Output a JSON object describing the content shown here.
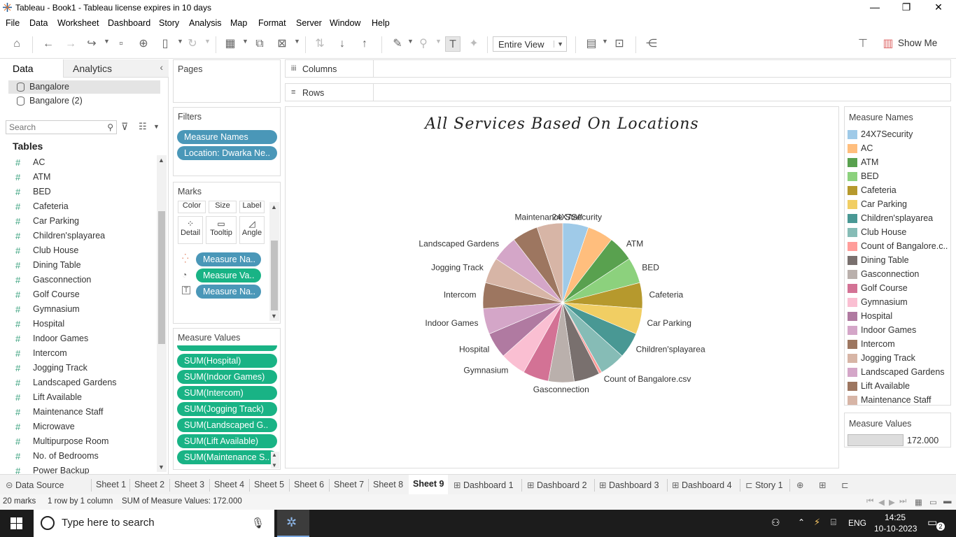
{
  "window": {
    "title": "Tableau - Book1 - Tableau license expires in 10 days"
  },
  "menu": [
    "File",
    "Data",
    "Worksheet",
    "Dashboard",
    "Story",
    "Analysis",
    "Map",
    "Format",
    "Server",
    "Window",
    "Help"
  ],
  "toolbar": {
    "view_select": "Entire View",
    "show_me": "Show Me"
  },
  "left_pane": {
    "tabs": [
      "Data",
      "Analytics"
    ],
    "datasources": [
      "Bangalore",
      "Bangalore (2)"
    ],
    "search_placeholder": "Search",
    "tables_heading": "Tables",
    "fields": [
      "AC",
      "ATM",
      "BED",
      "Cafeteria",
      "Car Parking",
      "Children'splayarea",
      "Club House",
      "Dining Table",
      "Gasconnection",
      "Golf Course",
      "Gymnasium",
      "Hospital",
      "Indoor Games",
      "Intercom",
      "Jogging Track",
      "Landscaped Gardens",
      "Lift Available",
      "Maintenance Staff",
      "Microwave",
      "Multipurpose Room",
      "No. of Bedrooms",
      "Power Backup"
    ]
  },
  "pages": {
    "title": "Pages"
  },
  "filters": {
    "title": "Filters",
    "pills": [
      "Measure Names",
      "Location: Dwarka Ne.."
    ]
  },
  "marks": {
    "title": "Marks",
    "buttons": [
      "Color",
      "Size",
      "Label",
      "Detail",
      "Tooltip",
      "Angle"
    ],
    "pills": [
      "Measure Na..",
      "Measure Va..",
      "Measure Na.."
    ]
  },
  "measure_values_shelf": {
    "title": "Measure Values",
    "pills": [
      "SUM(Hospital)",
      "SUM(Indoor Games)",
      "SUM(Intercom)",
      "SUM(Jogging Track)",
      "SUM(Landscaped G..",
      "SUM(Lift Available)",
      "SUM(Maintenance S.."
    ]
  },
  "shelves": {
    "columns": "Columns",
    "rows": "Rows"
  },
  "chart_data": {
    "type": "pie",
    "title": "All Services Based On Locations",
    "labels": [
      "24X7Security",
      "ATM",
      "BED",
      "Cafeteria",
      "Car Parking",
      "Children'splayarea",
      "Count of Bangalore.csv",
      "Gasconnection",
      "Gymnasium",
      "Hospital",
      "Indoor Games",
      "Intercom",
      "Jogging Track",
      "Landscaped Gardens",
      "Maintenance Staff"
    ],
    "slices": [
      {
        "name": "24X7Security",
        "value": 9,
        "color": "#9fcae8"
      },
      {
        "name": "AC",
        "value": 9,
        "color": "#ffbe7d"
      },
      {
        "name": "ATM",
        "value": 9,
        "color": "#59a14f"
      },
      {
        "name": "BED",
        "value": 9,
        "color": "#8cd17d"
      },
      {
        "name": "Cafeteria",
        "value": 9,
        "color": "#b6992d"
      },
      {
        "name": "Car Parking",
        "value": 9,
        "color": "#f1ce63"
      },
      {
        "name": "Children'splayarea",
        "value": 9,
        "color": "#499894"
      },
      {
        "name": "Club House",
        "value": 9,
        "color": "#86bcb6"
      },
      {
        "name": "Count of Bangalore.csv",
        "value": 1,
        "color": "#ff9d9a"
      },
      {
        "name": "Dining Table",
        "value": 9,
        "color": "#79706e"
      },
      {
        "name": "Gasconnection",
        "value": 9,
        "color": "#bab0ac"
      },
      {
        "name": "Golf Course",
        "value": 9,
        "color": "#d37295"
      },
      {
        "name": "Gymnasium",
        "value": 9,
        "color": "#fabfd2"
      },
      {
        "name": "Hospital",
        "value": 9,
        "color": "#b07aa1"
      },
      {
        "name": "Indoor Games",
        "value": 9,
        "color": "#d4a6c8"
      },
      {
        "name": "Intercom",
        "value": 9,
        "color": "#9d7660"
      },
      {
        "name": "Jogging Track",
        "value": 9,
        "color": "#d7b5a6"
      },
      {
        "name": "Landscaped Gardens",
        "value": 9,
        "color": "#d4a6c8"
      },
      {
        "name": "Lift Available",
        "value": 9,
        "color": "#9d7660"
      },
      {
        "name": "Maintenance Staff",
        "value": 9,
        "color": "#d7b5a6"
      }
    ]
  },
  "legend": {
    "title": "Measure Names",
    "items": [
      {
        "label": "24X7Security",
        "color": "#9fcae8"
      },
      {
        "label": "AC",
        "color": "#ffbe7d"
      },
      {
        "label": "ATM",
        "color": "#59a14f"
      },
      {
        "label": "BED",
        "color": "#8cd17d"
      },
      {
        "label": "Cafeteria",
        "color": "#b6992d"
      },
      {
        "label": "Car Parking",
        "color": "#f1ce63"
      },
      {
        "label": "Children'splayarea",
        "color": "#499894"
      },
      {
        "label": "Club House",
        "color": "#86bcb6"
      },
      {
        "label": "Count of Bangalore.c..",
        "color": "#ff9d9a"
      },
      {
        "label": "Dining Table",
        "color": "#79706e"
      },
      {
        "label": "Gasconnection",
        "color": "#bab0ac"
      },
      {
        "label": "Golf Course",
        "color": "#d37295"
      },
      {
        "label": "Gymnasium",
        "color": "#fabfd2"
      },
      {
        "label": "Hospital",
        "color": "#b07aa1"
      },
      {
        "label": "Indoor Games",
        "color": "#d4a6c8"
      },
      {
        "label": "Intercom",
        "color": "#9d7660"
      },
      {
        "label": "Jogging Track",
        "color": "#d7b5a6"
      },
      {
        "label": "Landscaped Gardens",
        "color": "#d4a6c8"
      },
      {
        "label": "Lift Available",
        "color": "#9d7660"
      },
      {
        "label": "Maintenance Staff",
        "color": "#d7b5a6"
      }
    ]
  },
  "measure_values_card": {
    "title": "Measure Values",
    "value": "172.000"
  },
  "sheet_tabs": [
    "Data Source",
    "Sheet 1",
    "Sheet 2",
    "Sheet 3",
    "Sheet 4",
    "Sheet 5",
    "Sheet 6",
    "Sheet 7",
    "Sheet 8",
    "Sheet 9",
    "Dashboard 1",
    "Dashboard 2",
    "Dashboard 3",
    "Dashboard 4",
    "Story 1"
  ],
  "status": {
    "marks": "20 marks",
    "rows": "1 row by 1 column",
    "sum": "SUM of Measure Values: 172.000"
  },
  "taskbar": {
    "search_placeholder": "Type here to search",
    "lang": "ENG",
    "time": "14:25",
    "date": "10-10-2023",
    "notifications": "2"
  }
}
